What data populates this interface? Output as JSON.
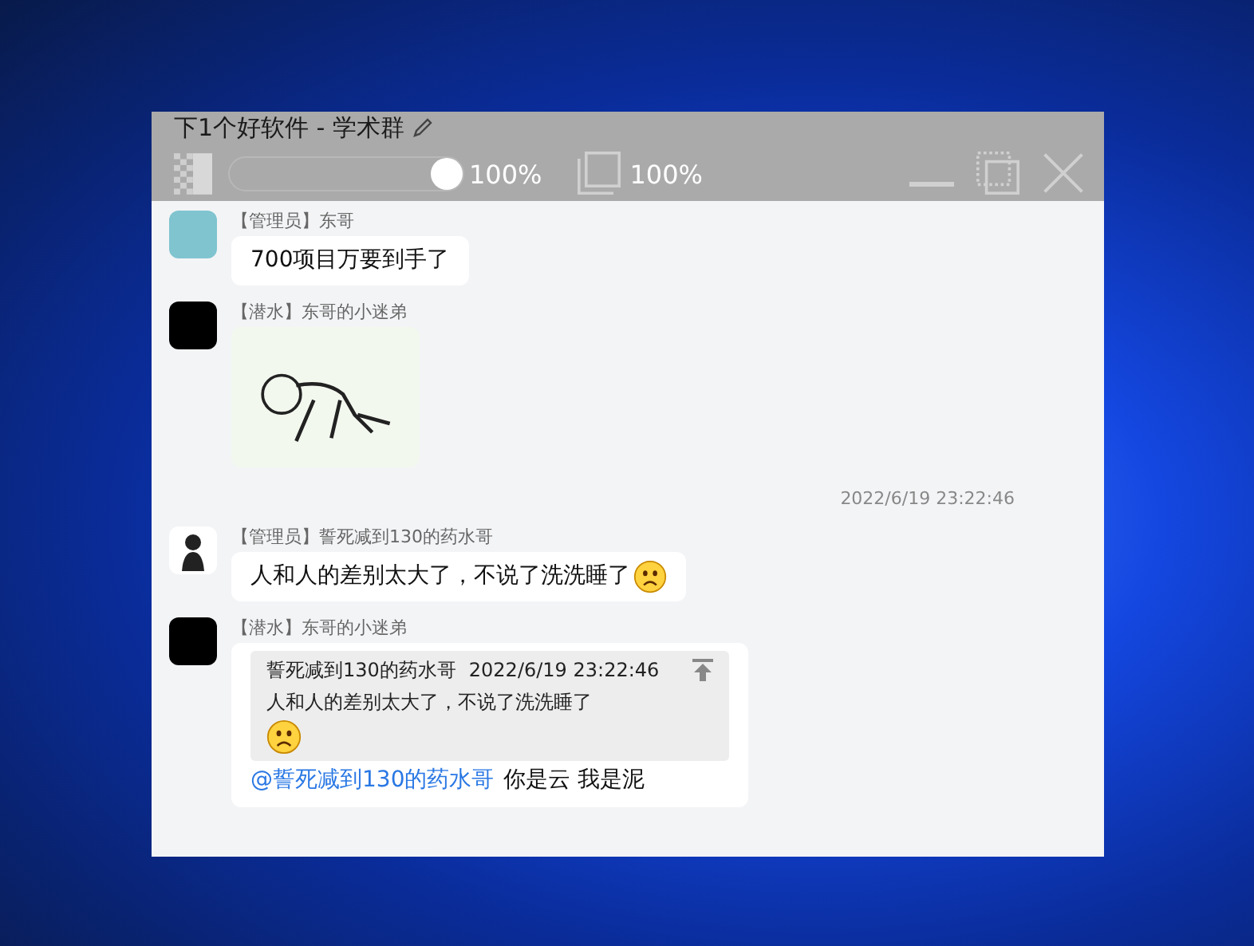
{
  "window": {
    "title": "下1个好软件 - 学术群"
  },
  "overlay": {
    "opacity_slider": {
      "level": 1
    },
    "opacity_reading": "100%",
    "scale_reading": "100%"
  },
  "messages": [
    {
      "kind": "text",
      "sender": "【管理员】东哥",
      "avatar": {
        "kind": "picture"
      },
      "text": "700项目万要到手了",
      "emoji": false
    },
    {
      "kind": "image",
      "sender": "【潜水】东哥的小迷弟",
      "avatar": {
        "kind": "dark"
      }
    },
    {
      "kind": "time",
      "text": "2022/6/19 23:22:46"
    },
    {
      "kind": "text",
      "sender": "【管理员】誓死减到130的药水哥",
      "avatar": {
        "kind": "silhouette"
      },
      "text": "人和人的差别太大了，不说了洗洗睡了",
      "emoji": true
    },
    {
      "kind": "reply",
      "sender": "【潜水】东哥的小迷弟",
      "avatar": {
        "kind": "dark"
      },
      "quote": {
        "author": "誓死减到130的药水哥",
        "time": "2022/6/19 23:22:46",
        "text": "人和人的差别太大了，不说了洗洗睡了",
        "emoji": true
      },
      "mention": "@誓死减到130的药水哥",
      "text": "你是云 我是泥"
    }
  ]
}
